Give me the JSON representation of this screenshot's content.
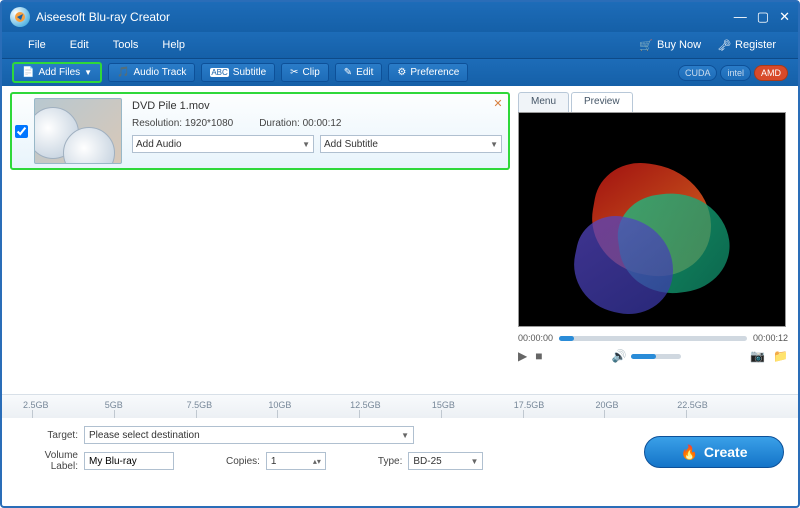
{
  "app": {
    "title": "Aiseesoft Blu-ray Creator"
  },
  "window": {
    "min": "—",
    "max": "▢",
    "close": "✕"
  },
  "menu": [
    "File",
    "Edit",
    "Tools",
    "Help"
  ],
  "actions": {
    "buy": "Buy Now",
    "buy_icon": "🛒",
    "register": "Register",
    "register_icon": "🗝"
  },
  "toolbar": {
    "add_files": "Add Files",
    "add_icon": "📄",
    "audio_track": "Audio Track",
    "audio_icon": "🎵",
    "subtitle": "Subtitle",
    "subtitle_icon": "ABC",
    "clip": "Clip",
    "clip_icon": "✂",
    "edit": "Edit",
    "edit_icon": "✎",
    "preference": "Preference",
    "pref_icon": "⚙"
  },
  "gpu": {
    "cuda": "CUDA",
    "intel": "intel",
    "amd": "AMD"
  },
  "file": {
    "name": "DVD Pile 1.mov",
    "res_label": "Resolution:",
    "res_value": "1920*1080",
    "dur_label": "Duration:",
    "dur_value": "00:00:12",
    "add_audio": "Add Audio",
    "add_subtitle": "Add Subtitle",
    "close": "✕",
    "checked": true
  },
  "preview": {
    "tab_menu": "Menu",
    "tab_preview": "Preview",
    "time_start": "00:00:00",
    "time_end": "00:00:12",
    "play": "▶",
    "stop": "■",
    "vol_icon": "🔊",
    "snap": "📷",
    "folder": "📁"
  },
  "ruler": [
    "2.5GB",
    "5GB",
    "7.5GB",
    "10GB",
    "12.5GB",
    "15GB",
    "17.5GB",
    "20GB",
    "22.5GB"
  ],
  "bottom": {
    "target_label": "Target:",
    "target_value": "Please select destination",
    "volume_label": "Volume Label:",
    "volume_value": "My Blu-ray",
    "copies_label": "Copies:",
    "copies_value": "1",
    "type_label": "Type:",
    "type_value": "BD-25",
    "create": "Create",
    "fire": "🔥"
  }
}
